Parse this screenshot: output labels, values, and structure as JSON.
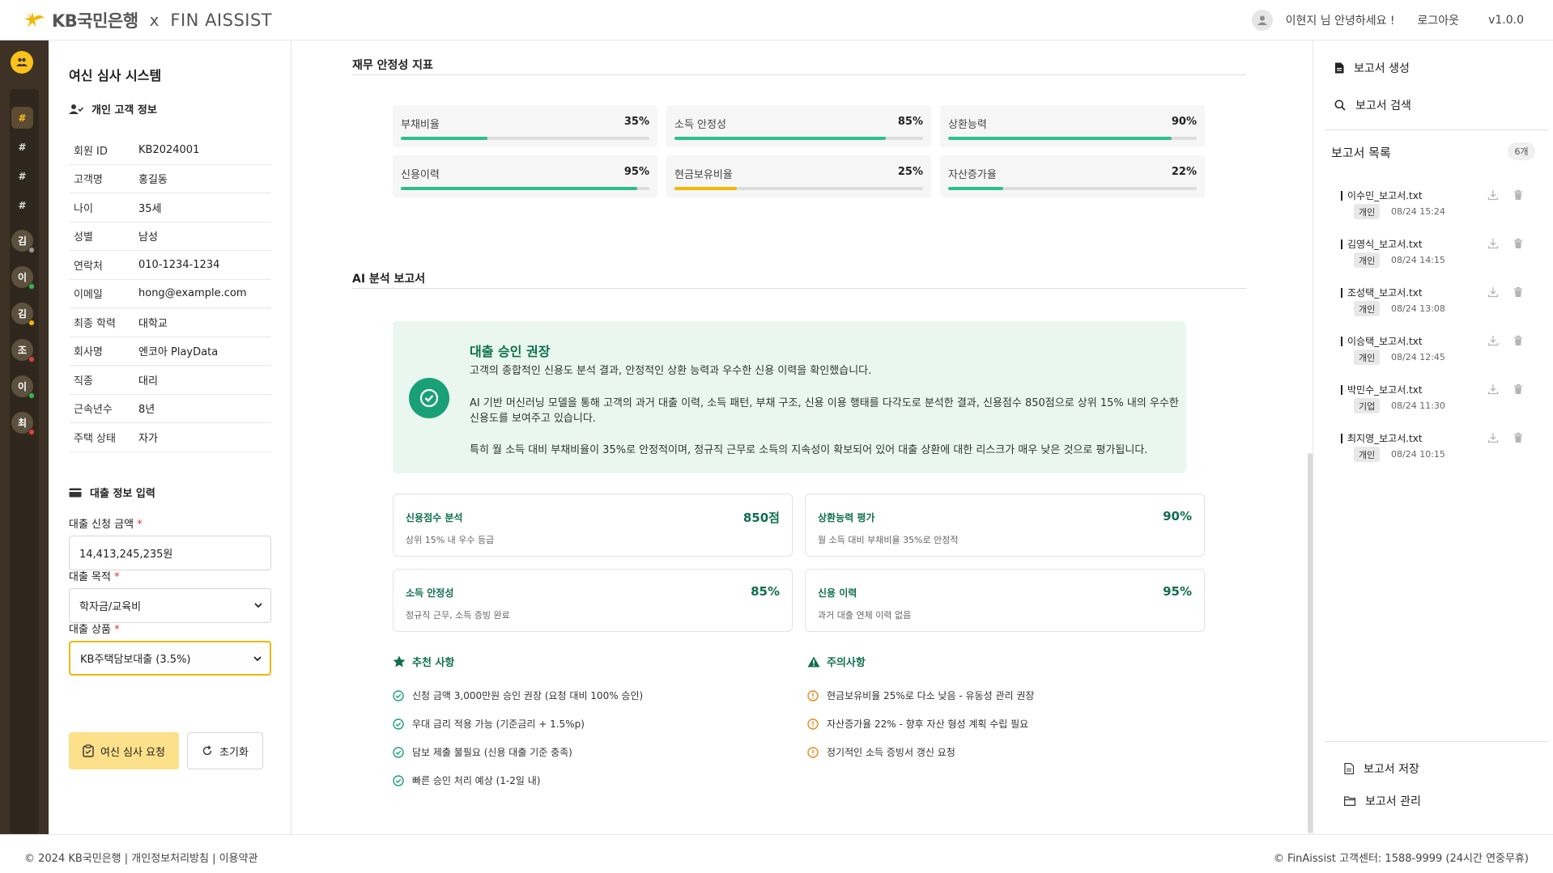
{
  "header": {
    "brand_kb": "KB국민은행",
    "brand_x": "x",
    "brand_fin": "FIN AISSIST",
    "greeting": "이현지 님 안녕하세요 !",
    "logout": "로그아웃",
    "version": "v1.0.0"
  },
  "rail": {
    "hash_items": [
      "#",
      "#",
      "#",
      "#"
    ],
    "users": [
      {
        "initial": "김",
        "status_color": "#9a9a9a"
      },
      {
        "initial": "이",
        "status_color": "#2dbb4e"
      },
      {
        "initial": "김",
        "status_color": "#f2b705"
      },
      {
        "initial": "조",
        "status_color": "#e03e3e"
      },
      {
        "initial": "이",
        "status_color": "#2dbb4e"
      },
      {
        "initial": "최",
        "status_color": "#e03e3e"
      }
    ]
  },
  "left": {
    "title": "여신 심사 시스템",
    "customer_section": "개인 고객 정보",
    "fields": [
      {
        "key": "회원 ID",
        "value": "KB2024001"
      },
      {
        "key": "고객명",
        "value": "홍길동"
      },
      {
        "key": "나이",
        "value": "35세"
      },
      {
        "key": "성별",
        "value": "남성"
      },
      {
        "key": "연락처",
        "value": "010-1234-1234"
      },
      {
        "key": "이메일",
        "value": "hong@example.com"
      },
      {
        "key": "최종 학력",
        "value": "대학교"
      },
      {
        "key": "회사명",
        "value": "엔코아 PlayData"
      },
      {
        "key": "직종",
        "value": "대리"
      },
      {
        "key": "근속년수",
        "value": "8년"
      },
      {
        "key": "주택 상태",
        "value": "자가"
      }
    ],
    "loan_section": "대출 정보 입력",
    "amount_label": "대출 신청 금액",
    "amount_value": "14,413,245,235원",
    "purpose_label": "대출 목적",
    "purpose_value": "학자금/교육비",
    "product_label": "대출 상품",
    "product_value": "KB주택담보대출 (3.5%)",
    "required_mark": "*",
    "submit": "여신 심사 요청",
    "reset": "초기화"
  },
  "main": {
    "stability_title": "재무 안정성 지표",
    "metrics": [
      {
        "label": "부채비율",
        "value": "35%",
        "level": 0.35,
        "color": "#2cbf8a"
      },
      {
        "label": "소득 안정성",
        "value": "85%",
        "level": 0.85,
        "color": "#2cbf8a"
      },
      {
        "label": "상환능력",
        "value": "90%",
        "level": 0.9,
        "color": "#2cbf8a"
      },
      {
        "label": "신용이력",
        "value": "95%",
        "level": 0.95,
        "color": "#2cbf8a"
      },
      {
        "label": "현금보유비율",
        "value": "25%",
        "level": 0.25,
        "color": "#f2b705"
      },
      {
        "label": "자산증가율",
        "value": "22%",
        "level": 0.22,
        "color": "#2cbf8a"
      }
    ],
    "report_title": "AI 분석 보고서",
    "reco_title": "대출 승인 권장",
    "reco_p1": "고객의 종합적인 신용도 분석 결과, 안정적인 상환 능력과 우수한 신용 이력을 확인했습니다.",
    "reco_p2": "AI 기반 머신러닝 모델을 통해 고객의 과거 대출 이력, 소득 패턴, 부채 구조, 신용 이용 행태를 다각도로 분석한 결과, 신용점수 850점으로 상위 15% 내의 우수한 신용도를 보여주고 있습니다.",
    "reco_p3": "특히 월 소득 대비 부채비율이 35%로 안정적이며, 정규직 근무로 소득의 지속성이 확보되어 있어 대출 상환에 대한 리스크가 매우 낮은 것으로 평가됩니다.",
    "cards": [
      {
        "title": "신용점수 분석",
        "value": "850점",
        "sub": "상위 15% 내 우수 등급"
      },
      {
        "title": "상환능력 평가",
        "value": "90%",
        "sub": "월 소득 대비 부채비율 35%로 안정적"
      },
      {
        "title": "소득 안정성",
        "value": "85%",
        "sub": "정규직 근무, 소득 증빙 완료"
      },
      {
        "title": "신용 이력",
        "value": "95%",
        "sub": "과거 대출 연체 이력 없음"
      }
    ],
    "recommend_title": "추천 사항",
    "recommendations": [
      "신청 금액 3,000만원 승인 권장 (요청 대비 100% 승인)",
      "우대 금리 적용 가능 (기준금리 + 1.5%p)",
      "담보 제출 불필요 (신용 대출 기준 충족)",
      "빠른 승인 처리 예상 (1-2일 내)"
    ],
    "caution_title": "주의사항",
    "cautions": [
      "현금보유비율 25%로 다소 낮음 - 유동성 관리 권장",
      "자산증가율 22% - 향후 자산 형성 계획 수립 필요",
      "정기적인 소득 증빙서 갱신 요청"
    ]
  },
  "right": {
    "create": "보고서 생성",
    "search": "보고서 검색",
    "list_title": "보고서 목록",
    "count": "6개",
    "reports": [
      {
        "name": "이수민_보고서.txt",
        "tag": "개인",
        "date": "08/24 15:24"
      },
      {
        "name": "김영식_보고서.txt",
        "tag": "개인",
        "date": "08/24 14:15"
      },
      {
        "name": "조성택_보고서.txt",
        "tag": "개인",
        "date": "08/24 13:08"
      },
      {
        "name": "이승택_보고서.txt",
        "tag": "개인",
        "date": "08/24 12:45"
      },
      {
        "name": "박민수_보고서.txt",
        "tag": "기업",
        "date": "08/24 11:30"
      },
      {
        "name": "최지영_보고서.txt",
        "tag": "개인",
        "date": "08/24 10:15"
      }
    ],
    "save": "보고서 저장",
    "manage": "보고서 관리"
  },
  "footer": {
    "left": "© 2024 KB국민은행 | 개인정보처리방침 | 이용약관",
    "right": "© FinAissist 고객센터: 1588-9999 (24시간 연중무휴)"
  }
}
